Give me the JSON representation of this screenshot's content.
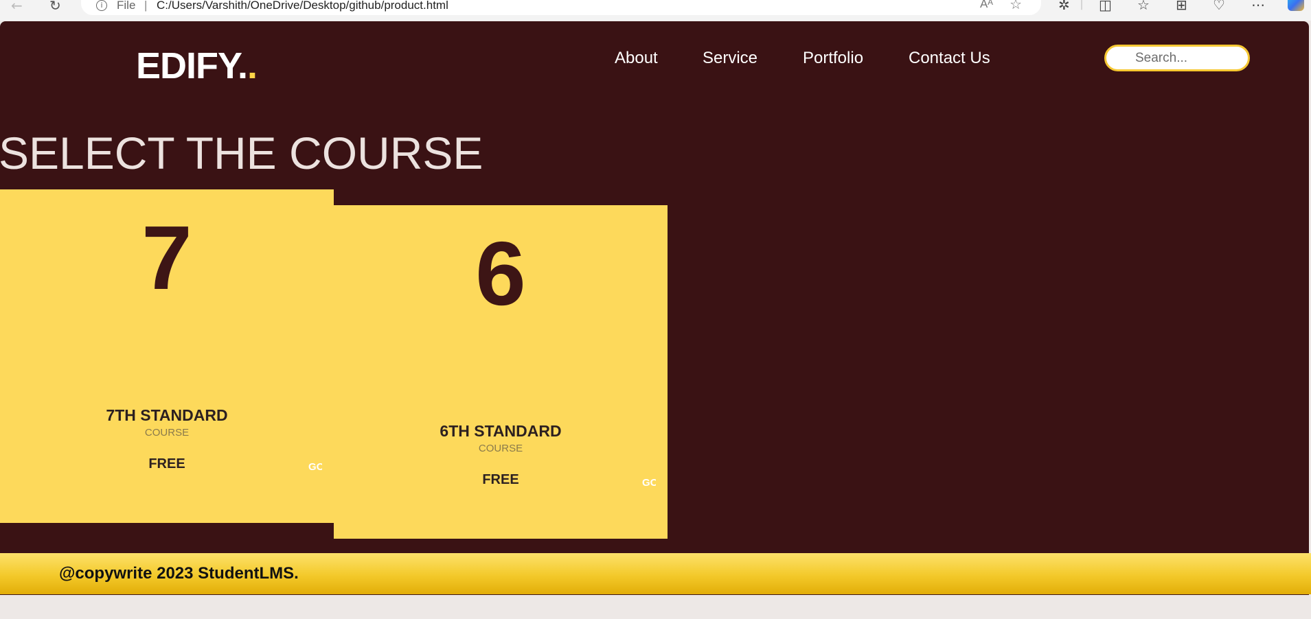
{
  "browser": {
    "file_label": "File",
    "separator": "|",
    "url": "C:/Users/Varshith/OneDrive/Desktop/github/product.html",
    "read_aloud": "Aᴬ",
    "icons": [
      "back-arrow-icon",
      "refresh-icon",
      "info-icon",
      "read-aloud-icon",
      "favorite-star-icon",
      "extensions-icon",
      "split-screen-icon",
      "favorites-icon",
      "collections-icon",
      "browser-essentials-icon",
      "more-icon",
      "copilot-icon"
    ]
  },
  "header": {
    "logo": "EDIFY.",
    "logo_dot": ".",
    "nav": [
      "About",
      "Service",
      "Portfolio",
      "Contact Us"
    ],
    "search_placeholder": "Search..."
  },
  "main": {
    "title": "SELECT THE COURSE",
    "courses": [
      {
        "number": "7",
        "title": "7TH STANDARD",
        "subtitle": "COURSE",
        "price": "FREE",
        "action": "GO"
      },
      {
        "number": "6",
        "title": "6TH STANDARD",
        "subtitle": "COURSE",
        "price": "FREE",
        "action": "GO"
      }
    ]
  },
  "footer": {
    "copyright": "@copywrite 2023 StudentLMS."
  },
  "colors": {
    "page_background": "#3a1214",
    "card": "#fdd95b",
    "accent": "#fcd447",
    "footer_gradient_top": "#fde16a",
    "footer_gradient_bottom": "#e2ad08"
  }
}
